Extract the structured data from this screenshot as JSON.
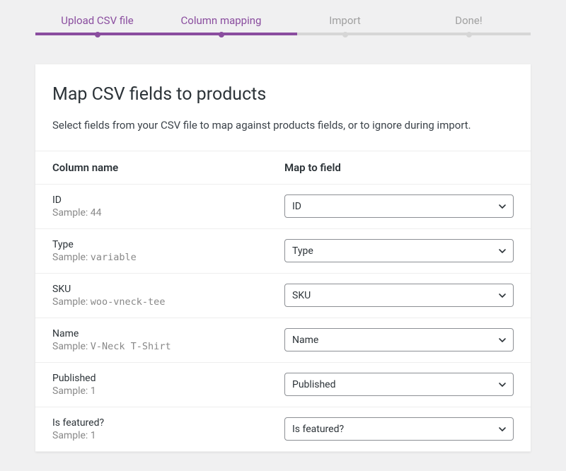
{
  "progress": {
    "steps": [
      {
        "label": "Upload CSV file",
        "state": "done"
      },
      {
        "label": "Column mapping",
        "state": "active"
      },
      {
        "label": "Import",
        "state": "pending"
      },
      {
        "label": "Done!",
        "state": "pending"
      }
    ]
  },
  "header": {
    "title": "Map CSV fields to products",
    "description": "Select fields from your CSV file to map against products fields, or to ignore during import."
  },
  "table": {
    "columns": {
      "name": "Column name",
      "map": "Map to field"
    },
    "sample_prefix": "Sample:",
    "rows": [
      {
        "name": "ID",
        "sample": "44",
        "mono": false,
        "selected": "ID"
      },
      {
        "name": "Type",
        "sample": "variable",
        "mono": true,
        "selected": "Type"
      },
      {
        "name": "SKU",
        "sample": "woo-vneck-tee",
        "mono": true,
        "selected": "SKU"
      },
      {
        "name": "Name",
        "sample": "V-Neck T-Shirt",
        "mono": true,
        "selected": "Name"
      },
      {
        "name": "Published",
        "sample": "1",
        "mono": false,
        "selected": "Published"
      },
      {
        "name": "Is featured?",
        "sample": "1",
        "mono": false,
        "selected": "Is featured?"
      }
    ]
  }
}
